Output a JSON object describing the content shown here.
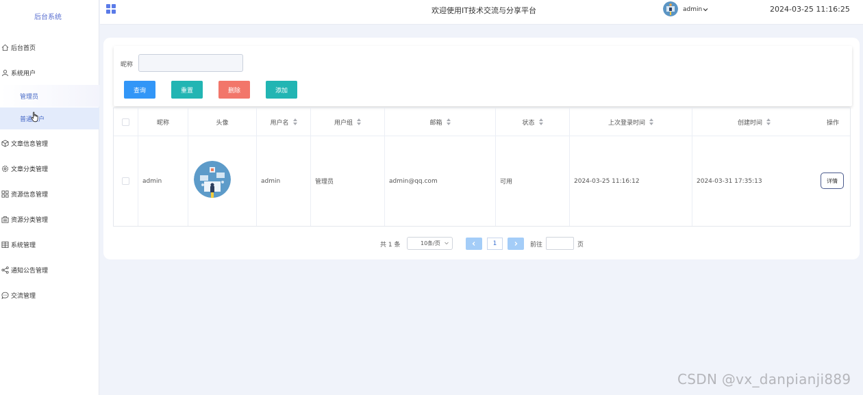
{
  "sidebar": {
    "brand": "后台系统",
    "items": [
      {
        "label": "后台首页",
        "icon": "home-icon"
      },
      {
        "label": "系统用户",
        "icon": "user-icon"
      },
      {
        "label": "文章信息管理",
        "icon": "cube-icon"
      },
      {
        "label": "文章分类管理",
        "icon": "gear-icon"
      },
      {
        "label": "资源信息管理",
        "icon": "grid-icon"
      },
      {
        "label": "资源分类管理",
        "icon": "briefcase-icon"
      },
      {
        "label": "系统管理",
        "icon": "table-icon"
      },
      {
        "label": "通知公告管理",
        "icon": "share-icon"
      },
      {
        "label": "交流管理",
        "icon": "chat-icon"
      }
    ],
    "sub_items": [
      {
        "label": "管理员",
        "active": false
      },
      {
        "label": "普通用户",
        "active": true
      }
    ]
  },
  "header": {
    "title": "欢迎使用IT技术交流与分享平台",
    "username": "admin",
    "datetime": "2024-03-25 11:16:25"
  },
  "search": {
    "label": "昵称",
    "value": "",
    "buttons": {
      "query": "查询",
      "reset": "重置",
      "delete": "删除",
      "add": "添加"
    }
  },
  "table": {
    "columns": [
      "昵称",
      "头像",
      "用户名",
      "用户组",
      "邮箱",
      "状态",
      "上次登录时间",
      "创建时间",
      "操作"
    ],
    "rows": [
      {
        "nickname": "admin",
        "username": "admin",
        "group": "管理员",
        "email": "admin@qq.com",
        "status": "可用",
        "last_login": "2024-03-25 11:16:12",
        "created": "2024-03-31 17:35:13",
        "action": "详情"
      }
    ]
  },
  "pagination": {
    "total": "共 1 条",
    "page_size": "10条/页",
    "current_page": "1",
    "goto_label": "前往",
    "page_suffix": "页"
  },
  "watermark": "CSDN @vx_danpianji889",
  "colors": {
    "primary": "#3296f7",
    "teal": "#22b5b3",
    "danger": "#f2766a",
    "sidebar_active": "#e3ebfb",
    "page_bg": "#f0f3fa"
  }
}
